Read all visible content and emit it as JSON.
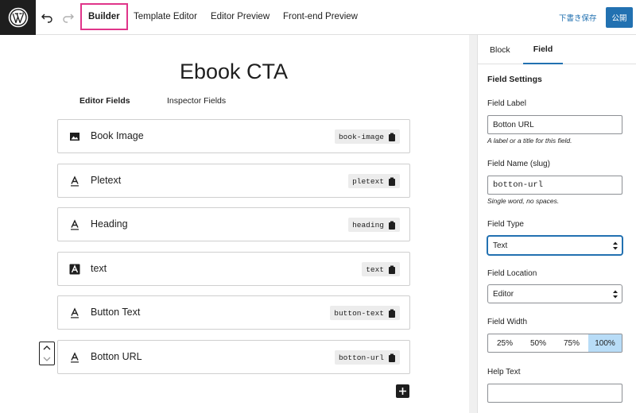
{
  "topbar": {
    "nav_tabs": [
      "Builder",
      "Template Editor",
      "Editor Preview",
      "Front-end Preview"
    ],
    "active_tab": "Builder",
    "save_draft_label": "下書き保存",
    "publish_label": "公開"
  },
  "canvas": {
    "title": "Ebook CTA",
    "field_tabs": [
      "Editor Fields",
      "Inspector Fields"
    ],
    "fields": [
      {
        "name": "Book Image",
        "slug": "book-image",
        "icon": "image-icon"
      },
      {
        "name": "Pletext",
        "slug": "pletext",
        "icon": "text-icon"
      },
      {
        "name": "Heading",
        "slug": "heading",
        "icon": "text-icon"
      },
      {
        "name": "text",
        "slug": "text",
        "icon": "text-filled-icon"
      },
      {
        "name": "Button Text",
        "slug": "button-text",
        "icon": "text-icon"
      },
      {
        "name": "Botton URL",
        "slug": "botton-url",
        "icon": "text-icon"
      }
    ]
  },
  "sidebar": {
    "tabs": [
      "Block",
      "Field"
    ],
    "active_tab": "Field",
    "heading": "Field Settings",
    "field_label": {
      "label": "Field Label",
      "value": "Botton URL",
      "help": "A label or a title for this field."
    },
    "field_name": {
      "label": "Field Name (slug)",
      "value": "botton-url",
      "help": "Single word, no spaces."
    },
    "field_type": {
      "label": "Field Type",
      "value": "Text"
    },
    "field_location": {
      "label": "Field Location",
      "value": "Editor"
    },
    "field_width": {
      "label": "Field Width",
      "options": [
        "25%",
        "50%",
        "75%",
        "100%"
      ],
      "selected": "100%"
    },
    "help_text": {
      "label": "Help Text",
      "value": ""
    }
  },
  "colors": {
    "accent": "#2271b1",
    "highlight": "#e0358a",
    "width_selected": "#b8dcf7"
  }
}
